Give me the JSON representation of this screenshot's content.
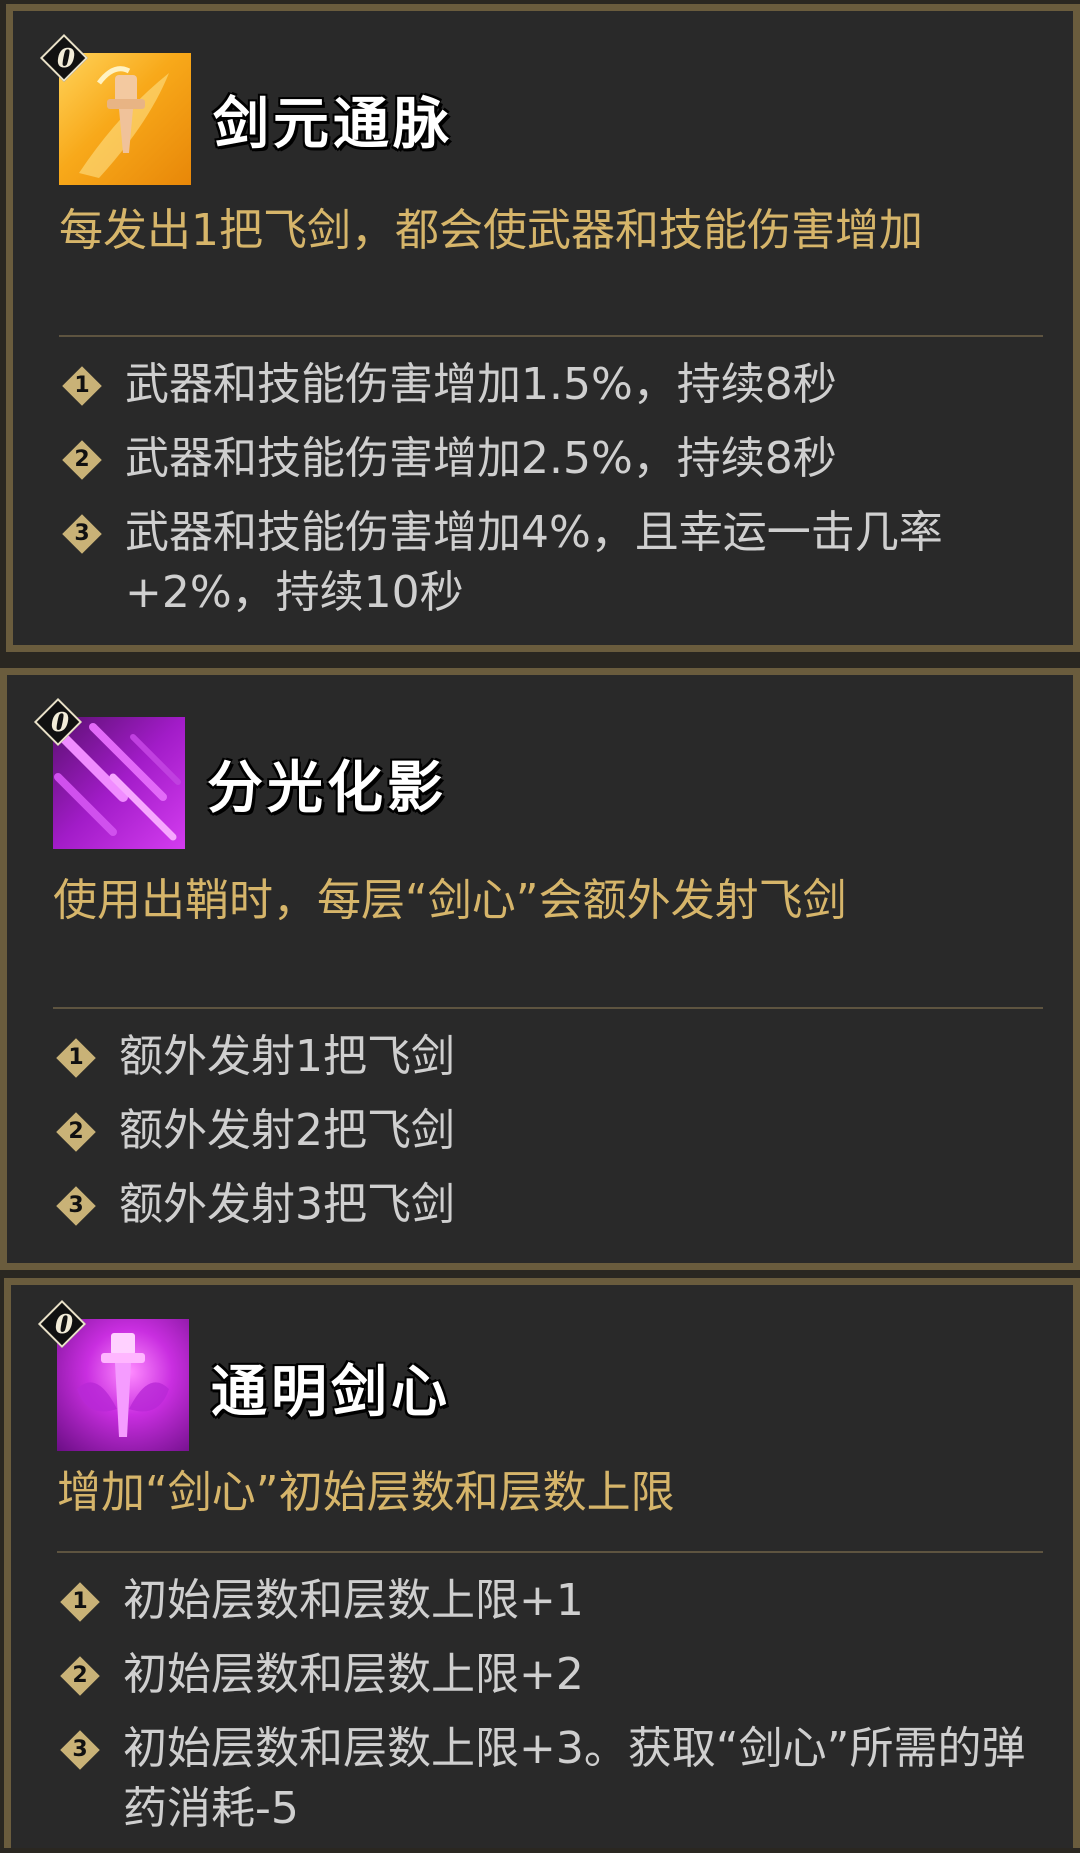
{
  "cards": [
    {
      "tier": "0",
      "title": "剑元通脉",
      "description": "每发出1把飞剑，都会使武器和技能伤害增加",
      "levels": [
        {
          "num": "1",
          "text": "武器和技能伤害增加1.5%，持续8秒"
        },
        {
          "num": "2",
          "text": "武器和技能伤害增加2.5%，持续8秒"
        },
        {
          "num": "3",
          "text": "武器和技能伤害增加4%，且幸运一击几率+2%，持续10秒"
        }
      ]
    },
    {
      "tier": "0",
      "title": "分光化影",
      "description": "使用出鞘时，每层“剑心”会额外发射飞剑",
      "levels": [
        {
          "num": "1",
          "text": "额外发射1把飞剑"
        },
        {
          "num": "2",
          "text": "额外发射2把飞剑"
        },
        {
          "num": "3",
          "text": "额外发射3把飞剑"
        }
      ]
    },
    {
      "tier": "0",
      "title": "通明剑心",
      "description": "增加“剑心”初始层数和层数上限",
      "levels": [
        {
          "num": "1",
          "text": "初始层数和层数上限+1"
        },
        {
          "num": "2",
          "text": "初始层数和层数上限+2"
        },
        {
          "num": "3",
          "text": "初始层数和层数上限+3。获取“剑心”所需的弹药消耗-5"
        }
      ]
    }
  ],
  "icons": [
    "sword-pulse-icon",
    "sword-shadows-icon",
    "sword-heart-icon"
  ],
  "colors": {
    "card_bg": "#292929",
    "card_border": "#6a5c3d",
    "description": "#d6b56a",
    "level_text": "#cfcfcf",
    "level_badge": "#c9b277"
  }
}
